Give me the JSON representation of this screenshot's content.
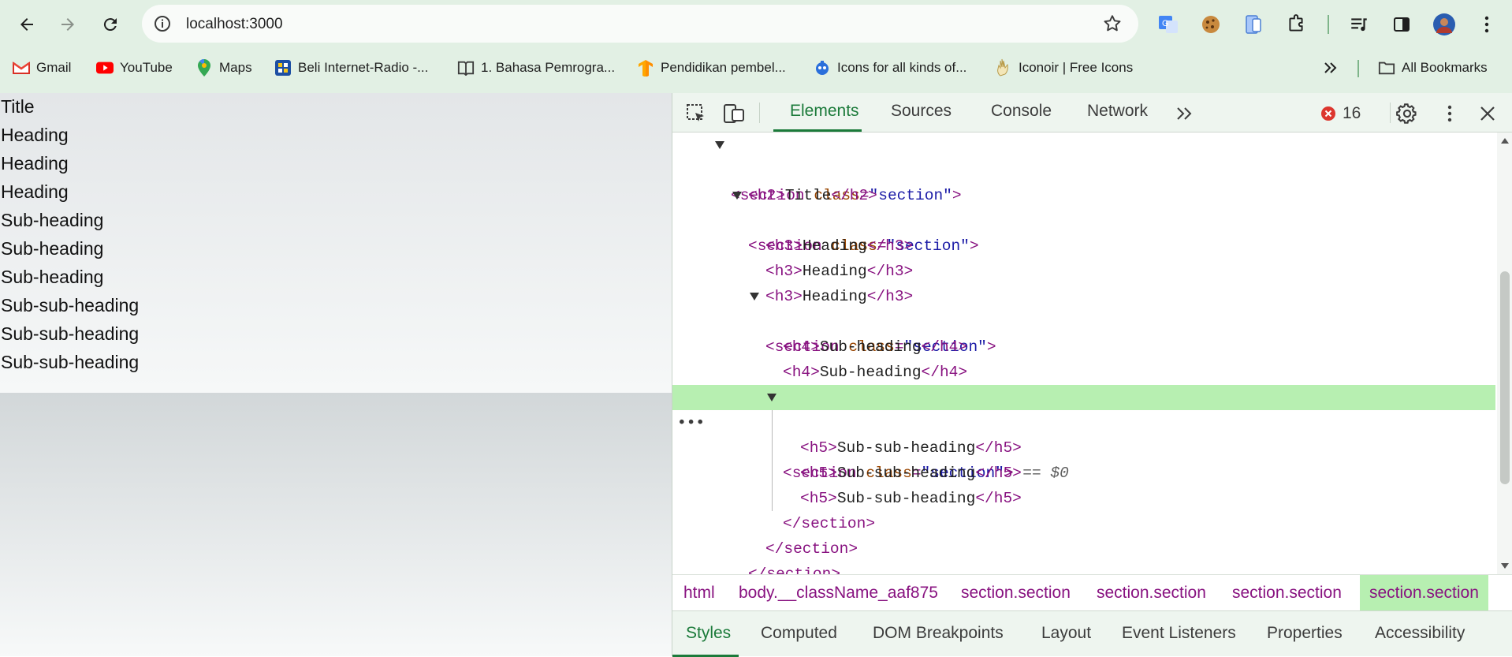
{
  "browser": {
    "url": "localhost:3000",
    "bookmarks": [
      {
        "label": "Gmail",
        "icon": "gmail-icon"
      },
      {
        "label": "YouTube",
        "icon": "youtube-icon"
      },
      {
        "label": "Maps",
        "icon": "maps-icon"
      },
      {
        "label": "Beli Internet-Radio -...",
        "icon": "radio-icon"
      },
      {
        "label": "1. Bahasa Pemrogra...",
        "icon": "book-icon"
      },
      {
        "label": "Pendidikan pembel...",
        "icon": "tensorflow-icon"
      },
      {
        "label": "Icons for all kinds of...",
        "icon": "icons-site-icon"
      },
      {
        "label": "Iconoir | Free Icons",
        "icon": "iconoir-icon"
      }
    ],
    "all_bookmarks": "All Bookmarks"
  },
  "page": {
    "lines": [
      "Title",
      "Heading",
      "Heading",
      "Heading",
      "Sub-heading",
      "Sub-heading",
      "Sub-heading",
      "Sub-sub-heading",
      "Sub-sub-heading",
      "Sub-sub-heading"
    ]
  },
  "devtools": {
    "tabs": [
      "Elements",
      "Sources",
      "Console",
      "Network"
    ],
    "error_count": "16",
    "dom_text": {
      "section_open": "<section",
      "class_attr": "class",
      "class_value": "\"section\"",
      "close_bracket": ">",
      "selected_marker": "== $0",
      "title": "Title",
      "heading": "Heading",
      "subheading": "Sub-heading",
      "subsubheading": "Sub-sub-heading",
      "section_close": "</section>",
      "h2_open": "<h2>",
      "h2_close": "</h2>",
      "h3_open": "<h3>",
      "h3_close": "</h3>",
      "h4_open": "<h4>",
      "h4_close": "</h4>",
      "h5_open": "<h5>",
      "h5_close": "</h5>",
      "ellipsis": "•••"
    },
    "breadcrumbs": [
      "html",
      "body.__className_aaf875",
      "section.section",
      "section.section",
      "section.section",
      "section.section"
    ],
    "style_tabs": [
      "Styles",
      "Computed",
      "DOM Breakpoints",
      "Layout",
      "Event Listeners",
      "Properties",
      "Accessibility"
    ]
  }
}
